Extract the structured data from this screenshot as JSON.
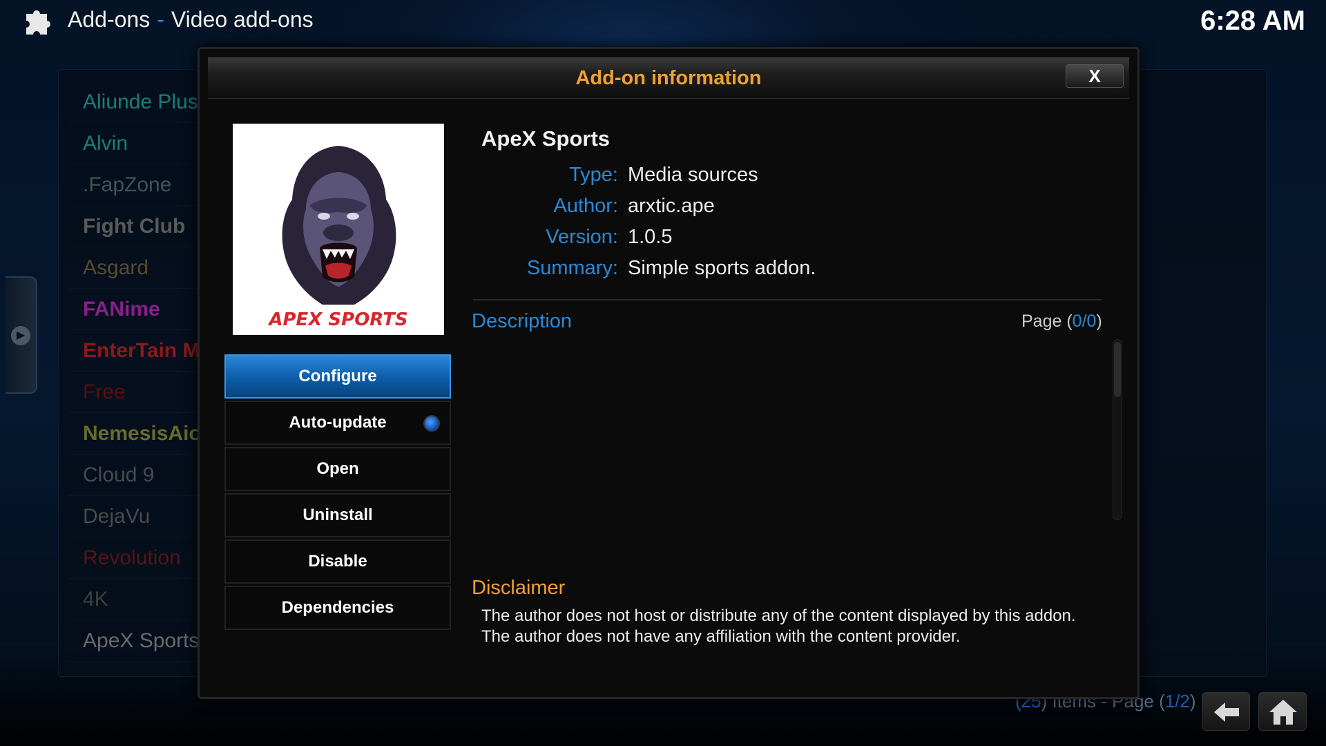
{
  "header": {
    "section": "Add-ons",
    "separator": "-",
    "subsection": "Video add-ons",
    "clock": "6:28 AM"
  },
  "addon_list": [
    {
      "label": "Aliunde Plus",
      "color": "#1b7d7a"
    },
    {
      "label": "Alvin",
      "color": "#1b7d7a"
    },
    {
      "label": ".FapZone",
      "color": "#3f5552"
    },
    {
      "label": "Fight Club",
      "color": "#5a5a5a",
      "bold": true
    },
    {
      "label": "Asgard",
      "color": "#5a4a30"
    },
    {
      "label": "FANime",
      "color": "#8a1f8a",
      "bold": true
    },
    {
      "label": "EnterTain M",
      "color": "#8a1a1a",
      "bold": true
    },
    {
      "label": "Free",
      "color": "#5a0f0f"
    },
    {
      "label": "NemesisAio",
      "color": "#6a6a28",
      "bold": true
    },
    {
      "label": "Cloud 9",
      "color": "#4a4a4a"
    },
    {
      "label": "DejaVu",
      "color": "#4a4a4a"
    },
    {
      "label": "Revolution",
      "color": "#5a1414"
    },
    {
      "label": "4K",
      "color": "#3e3e3e"
    },
    {
      "label": "ApeX Sports",
      "color": "#6a6a6a"
    }
  ],
  "items_footer": {
    "open": "(",
    "count": "25",
    "middle": ") Items - Page (",
    "page": "1/2",
    "close": ")"
  },
  "dialog": {
    "title": "Add-on information",
    "close_label": "X",
    "thumbnail_text": "APEX SPORTS",
    "buttons": [
      {
        "label": "Configure"
      },
      {
        "label": "Auto-update"
      },
      {
        "label": "Open"
      },
      {
        "label": "Uninstall"
      },
      {
        "label": "Disable"
      },
      {
        "label": "Dependencies"
      }
    ],
    "addon_name": "ApeX Sports",
    "properties": [
      {
        "key": "Type:",
        "value": "Media sources"
      },
      {
        "key": "Author:",
        "value": "arxtic.ape"
      },
      {
        "key": "Version:",
        "value": "1.0.5"
      },
      {
        "key": "Summary:",
        "value": "Simple sports addon."
      }
    ],
    "description_label": "Description",
    "page_prefix": "Page (",
    "page_value": "0/0",
    "page_suffix": ")",
    "disclaimer_label": "Disclaimer",
    "disclaimer_text": "The author does not host or distribute any of the content displayed by this addon. The author does not have any affiliation with the content provider."
  },
  "colors": {
    "accent_blue": "#2a8ad8",
    "accent_orange": "#f0a032",
    "focus_blue": "#0d5ca8"
  },
  "icons": {
    "header": "puzzle-piece-icon",
    "side_tab": "chevron-right-icon",
    "back": "back-arrow-icon",
    "home": "home-icon",
    "close": "close-icon",
    "toggle": "radio-on-icon"
  }
}
